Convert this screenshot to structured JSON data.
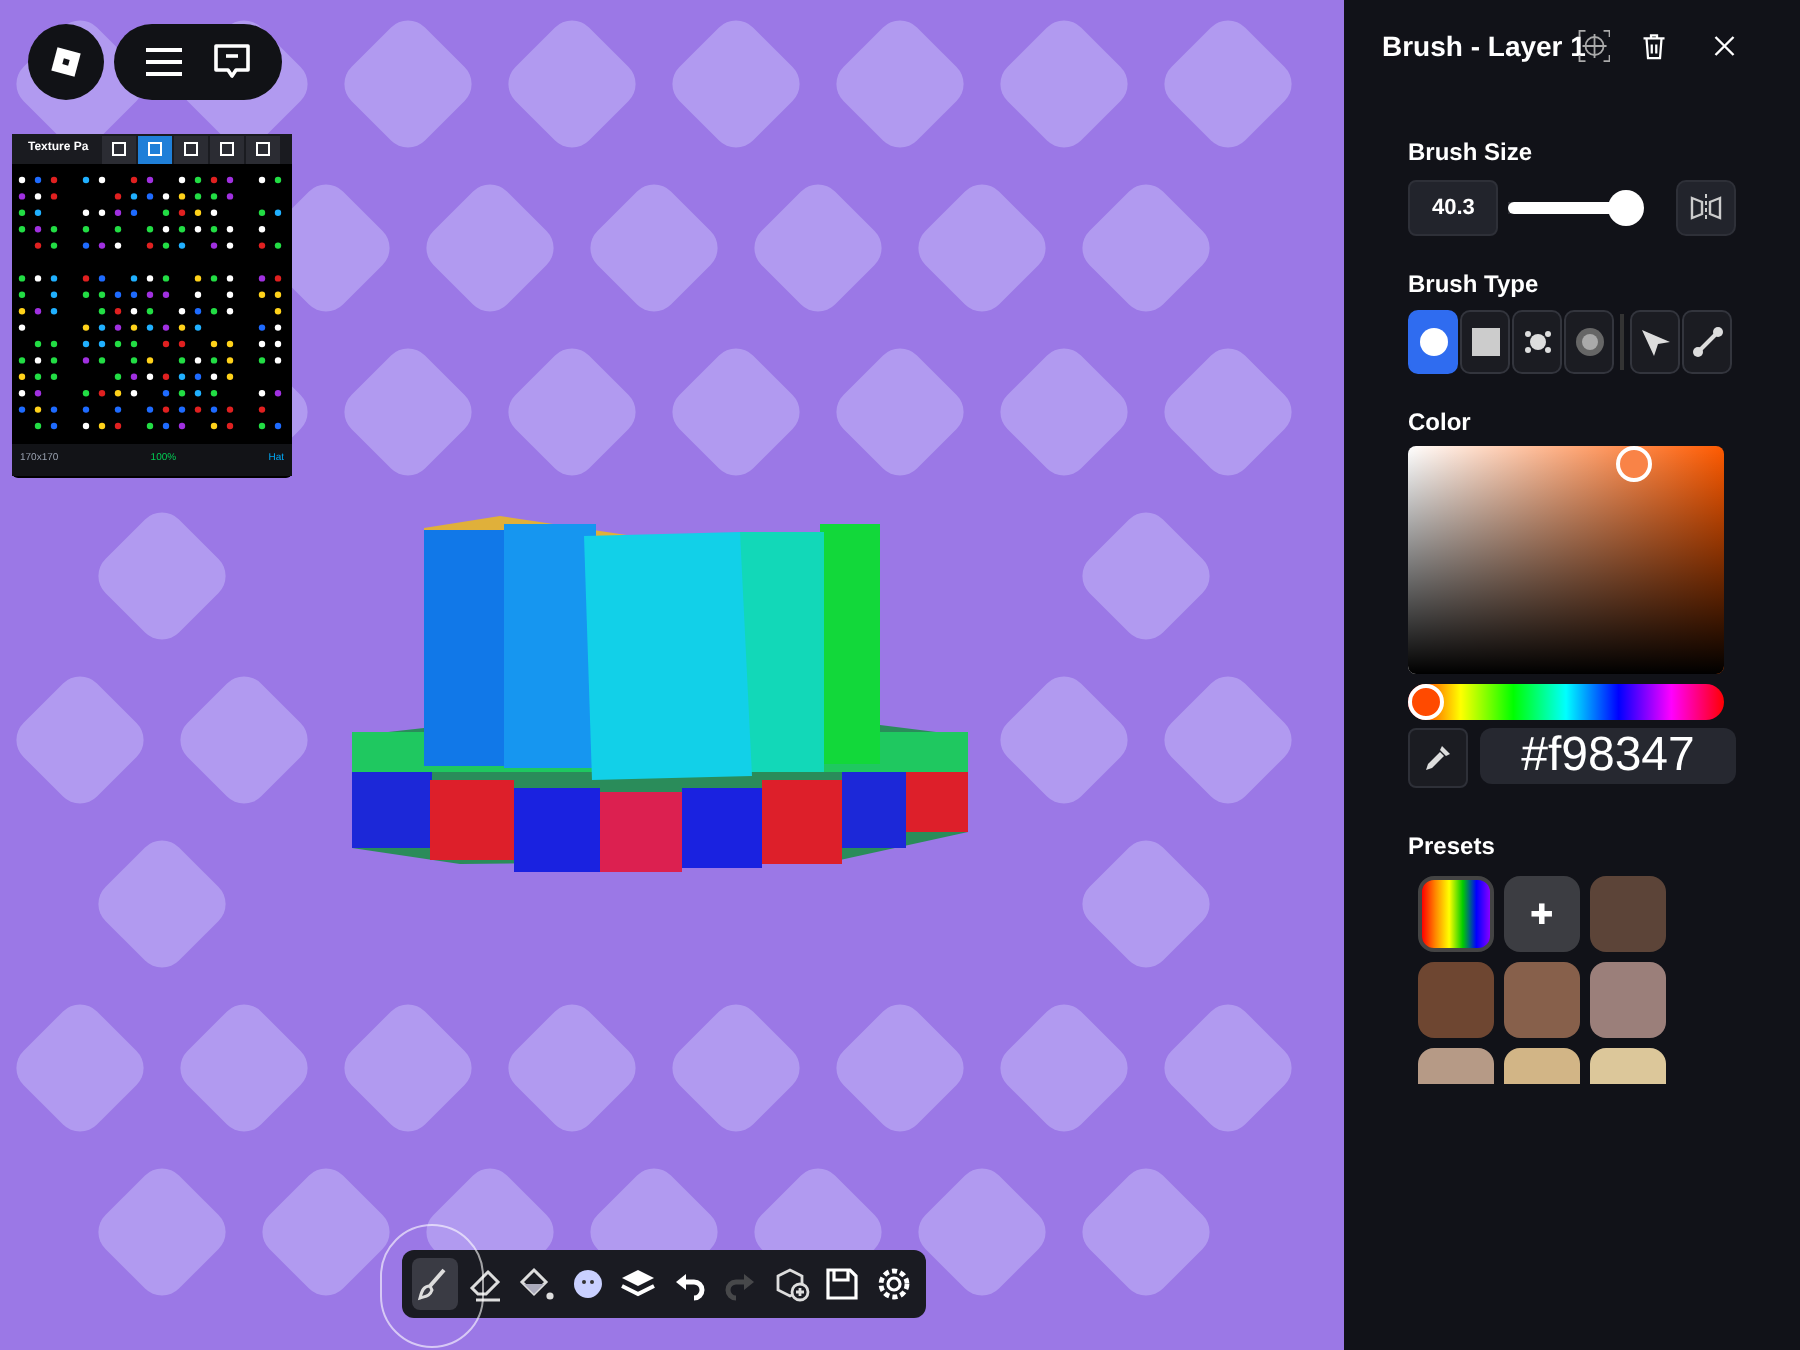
{
  "texture_panel": {
    "title": "Texture Pa",
    "tabs": [
      {
        "selected": false
      },
      {
        "selected": true
      },
      {
        "selected": false
      },
      {
        "selected": false
      },
      {
        "selected": false
      }
    ],
    "size": "170x170",
    "zoom": "100%",
    "part": "Hat"
  },
  "panel": {
    "title": "Brush - Layer 1",
    "brush_size": {
      "label": "Brush Size",
      "value": "40.3",
      "level": 0.88
    },
    "brush_type": {
      "label": "Brush Type",
      "types": [
        {
          "kind": "circle",
          "selected": true
        },
        {
          "kind": "square",
          "selected": false
        },
        {
          "kind": "splatter",
          "selected": false
        },
        {
          "kind": "soft",
          "selected": false
        },
        {
          "kind": "pen",
          "selected": false
        },
        {
          "kind": "line",
          "selected": false
        }
      ]
    },
    "color": {
      "label": "Color",
      "hue": {
        "level": 0.0
      },
      "hex": "#f98347"
    },
    "presets": {
      "label": "Presets",
      "items": [
        {
          "kind": "rainbow"
        },
        {
          "kind": "add",
          "text": "✚"
        },
        {
          "kind": "swatch",
          "color": "#5c4438"
        },
        {
          "kind": "swatch",
          "color": "#6e4631"
        },
        {
          "kind": "swatch",
          "color": "#87604b"
        },
        {
          "kind": "swatch",
          "color": "#9b7f7a"
        },
        {
          "kind": "swatch",
          "color": "#b69a86"
        },
        {
          "kind": "swatch",
          "color": "#d2b586"
        },
        {
          "kind": "swatch",
          "color": "#dcc79a"
        }
      ]
    }
  },
  "toolbar": [
    {
      "kind": "brush",
      "selected": true
    },
    {
      "kind": "eraser",
      "selected": false
    },
    {
      "kind": "fill",
      "selected": false
    },
    {
      "kind": "sticker",
      "selected": false
    },
    {
      "kind": "layers",
      "selected": false
    },
    {
      "kind": "undo",
      "selected": false
    },
    {
      "kind": "redo",
      "selected": false,
      "disabled": true
    },
    {
      "kind": "add-part",
      "selected": false
    },
    {
      "kind": "save",
      "selected": false
    },
    {
      "kind": "settings",
      "selected": false
    }
  ]
}
